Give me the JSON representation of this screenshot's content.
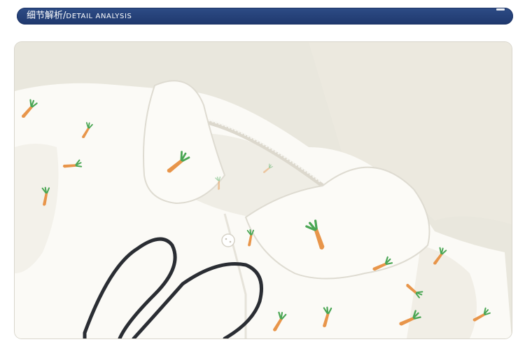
{
  "header": {
    "title_cn": "细节解析",
    "separator": "/",
    "title_en": "DETAIL ANALYSIS"
  },
  "photo": {
    "subject": "white shirt collar with embroidered carrots and bunny ears",
    "colors": {
      "background": "#e9e7dd",
      "fabric": "#fbfaf6",
      "fabric_shadow": "#e4e1d8",
      "carrot": "#e8954a",
      "leaf": "#4aa654",
      "bunny_outline": "#2a2d33",
      "banner": "#23407a"
    }
  }
}
